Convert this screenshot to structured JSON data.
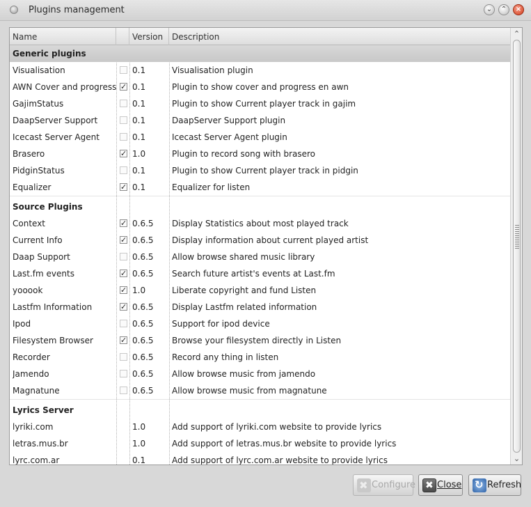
{
  "window": {
    "title": "Plugins management"
  },
  "columns": {
    "name": "Name",
    "version": "Version",
    "description": "Description"
  },
  "groups": [
    {
      "label": "Generic plugins",
      "rows": [
        {
          "name": "Visualisation",
          "checked": false,
          "version": "0.1",
          "description": "Visualisation plugin"
        },
        {
          "name": "AWN Cover and progress",
          "checked": true,
          "version": "0.1",
          "description": "Plugin to show cover and progress en awn"
        },
        {
          "name": "GajimStatus",
          "checked": false,
          "version": "0.1",
          "description": "Plugin to show Current player track in gajim"
        },
        {
          "name": "DaapServer Support",
          "checked": false,
          "version": "0.1",
          "description": "DaapServer Support plugin"
        },
        {
          "name": "Icecast Server Agent",
          "checked": false,
          "version": "0.1",
          "description": "Icecast Server Agent plugin"
        },
        {
          "name": "Brasero",
          "checked": true,
          "version": "1.0",
          "description": "Plugin to record song with brasero"
        },
        {
          "name": "PidginStatus",
          "checked": false,
          "version": "0.1",
          "description": "Plugin to show Current player track in pidgin"
        },
        {
          "name": "Equalizer",
          "checked": true,
          "version": "0.1",
          "description": "Equalizer for listen"
        }
      ]
    },
    {
      "label": "Source Plugins",
      "rows": [
        {
          "name": "Context",
          "checked": true,
          "version": "0.6.5",
          "description": "Display Statistics about most played track"
        },
        {
          "name": "Current Info",
          "checked": true,
          "version": "0.6.5",
          "description": "Display information about current played artist"
        },
        {
          "name": "Daap Support",
          "checked": false,
          "version": "0.6.5",
          "description": "Allow browse shared music library"
        },
        {
          "name": "Last.fm events",
          "checked": true,
          "version": "0.6.5",
          "description": "Search future artist's events at Last.fm"
        },
        {
          "name": "yooook",
          "checked": true,
          "version": "1.0",
          "description": "Liberate copyright and fund Listen"
        },
        {
          "name": "Lastfm Information",
          "checked": true,
          "version": "0.6.5",
          "description": "Display Lastfm related information"
        },
        {
          "name": "Ipod",
          "checked": false,
          "version": "0.6.5",
          "description": "Support for ipod device"
        },
        {
          "name": "Filesystem Browser",
          "checked": true,
          "version": "0.6.5",
          "description": "Browse your filesystem directly in Listen"
        },
        {
          "name": "Recorder",
          "checked": false,
          "version": "0.6.5",
          "description": "Record any thing in listen"
        },
        {
          "name": "Jamendo",
          "checked": false,
          "version": "0.6.5",
          "description": "Allow browse music from jamendo"
        },
        {
          "name": "Magnatune",
          "checked": false,
          "version": "0.6.5",
          "description": "Allow browse music from magnatune"
        }
      ]
    },
    {
      "label": "Lyrics Server",
      "rows": [
        {
          "name": "lyriki.com",
          "checked": null,
          "version": "1.0",
          "description": "Add support of lyriki.com website to provide lyrics"
        },
        {
          "name": "letras.mus.br",
          "checked": null,
          "version": "1.0",
          "description": "Add support of letras.mus.br website to provide lyrics"
        },
        {
          "name": "lyrc.com.ar",
          "checked": null,
          "version": "0.1",
          "description": "Add support of lyrc.com.ar website to provide lyrics"
        }
      ]
    }
  ],
  "buttons": {
    "configure": "Configure",
    "close": "Close",
    "refresh": "Refresh"
  }
}
